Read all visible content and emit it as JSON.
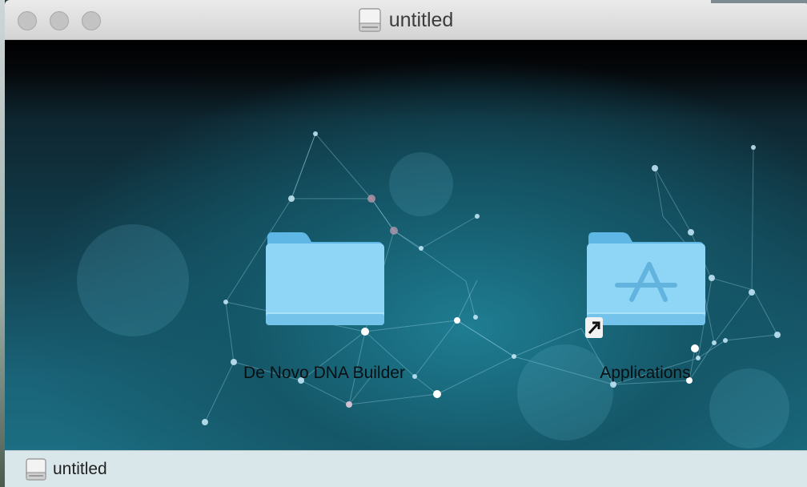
{
  "window": {
    "title": "untitled",
    "title_icon": "drive-icon"
  },
  "desktop_items": [
    {
      "label": "De Novo DNA Builder",
      "icon": "folder-icon"
    },
    {
      "label": "Applications",
      "icon": "applications-folder-icon",
      "alias": true
    }
  ],
  "statusbar": {
    "path_label": "untitled",
    "path_icon": "drive-icon"
  }
}
